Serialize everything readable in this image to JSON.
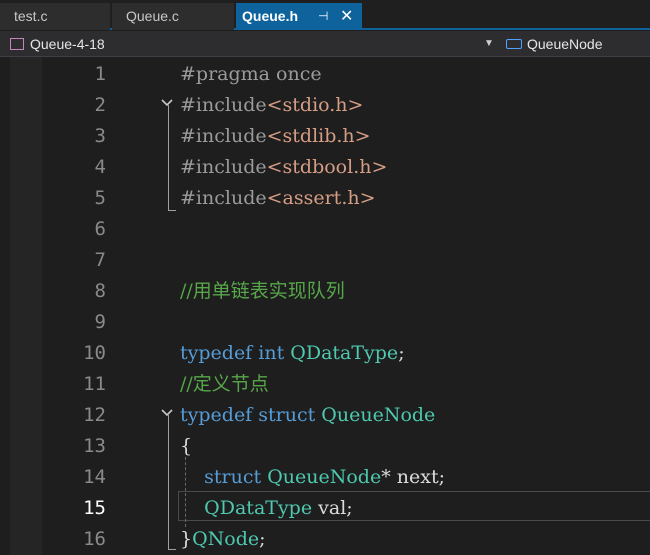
{
  "tabs": {
    "tab1": "test.c",
    "tab2": "Queue.c",
    "tab3": "Queue.h",
    "pin_glyph": "⊣",
    "close_glyph": "✕"
  },
  "navbar": {
    "scope": "Queue-4-18",
    "member": "QueueNode",
    "dropdown_glyph": "▼"
  },
  "lines": [
    {
      "n": "1",
      "parts": [
        {
          "c": "pp",
          "t": "#pragma once"
        }
      ]
    },
    {
      "n": "2",
      "parts": [
        {
          "c": "pp",
          "t": "#include"
        },
        {
          "c": "st",
          "t": "<stdio.h>"
        }
      ]
    },
    {
      "n": "3",
      "parts": [
        {
          "c": "pp",
          "t": "#include"
        },
        {
          "c": "st",
          "t": "<stdlib.h>"
        }
      ]
    },
    {
      "n": "4",
      "parts": [
        {
          "c": "pp",
          "t": "#include"
        },
        {
          "c": "st",
          "t": "<stdbool.h>"
        }
      ]
    },
    {
      "n": "5",
      "parts": [
        {
          "c": "pp",
          "t": "#include"
        },
        {
          "c": "st",
          "t": "<assert.h>"
        }
      ]
    },
    {
      "n": "6",
      "parts": []
    },
    {
      "n": "7",
      "parts": []
    },
    {
      "n": "8",
      "parts": [
        {
          "c": "cm",
          "t": "//用单链表实现队列"
        }
      ]
    },
    {
      "n": "9",
      "parts": []
    },
    {
      "n": "10",
      "parts": [
        {
          "c": "kw",
          "t": "typedef"
        },
        {
          "c": "tx",
          "t": " "
        },
        {
          "c": "kw",
          "t": "int"
        },
        {
          "c": "tx",
          "t": " "
        },
        {
          "c": "ty",
          "t": "QDataType"
        },
        {
          "c": "tx",
          "t": ";"
        }
      ]
    },
    {
      "n": "11",
      "parts": [
        {
          "c": "cm",
          "t": "//定义节点"
        }
      ]
    },
    {
      "n": "12",
      "parts": [
        {
          "c": "kw",
          "t": "typedef"
        },
        {
          "c": "tx",
          "t": " "
        },
        {
          "c": "kw",
          "t": "struct"
        },
        {
          "c": "tx",
          "t": " "
        },
        {
          "c": "ty",
          "t": "QueueNode"
        }
      ]
    },
    {
      "n": "13",
      "parts": [
        {
          "c": "tx",
          "t": "{"
        }
      ]
    },
    {
      "n": "14",
      "parts": [
        {
          "c": "tx",
          "t": "    "
        },
        {
          "c": "kw",
          "t": "struct"
        },
        {
          "c": "tx",
          "t": " "
        },
        {
          "c": "ty",
          "t": "QueueNode"
        },
        {
          "c": "tx",
          "t": "* next;"
        }
      ]
    },
    {
      "n": "15",
      "parts": [
        {
          "c": "tx",
          "t": "    "
        },
        {
          "c": "ty",
          "t": "QDataType"
        },
        {
          "c": "tx",
          "t": " val;"
        }
      ]
    },
    {
      "n": "16",
      "parts": [
        {
          "c": "tx",
          "t": "}"
        },
        {
          "c": "ty",
          "t": "QNode"
        },
        {
          "c": "tx",
          "t": ";"
        }
      ]
    }
  ]
}
